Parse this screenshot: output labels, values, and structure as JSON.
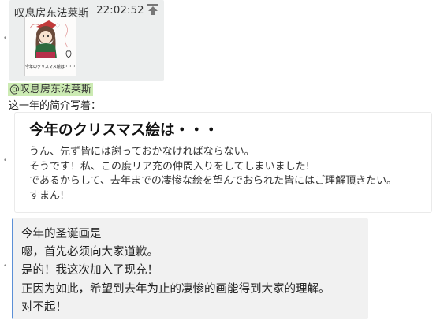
{
  "quote": {
    "sender": "叹息房东法莱斯",
    "time": "22:02:52",
    "icon": "upload-arrow-icon",
    "image_caption": "今年のクリスマス絵は・・・"
  },
  "bullet": "•",
  "mention": "@叹息房东法莱斯",
  "intro": "这一年的简介写着：",
  "card": {
    "title": "今年のクリスマス絵は・・・",
    "lines": [
      "うん、先ず皆には謝っておかなければならない。",
      "そうです！私、この度リア充の仲間入りをしてしまいました!",
      "であるからして、去年までの凄惨な絵を望んでおられた皆にはご理解頂きたい。",
      "すまん!"
    ]
  },
  "translation": {
    "lines": [
      "今年的圣诞画是",
      "嗯，首先必须向大家道歉。",
      "是的！我这次加入了现充！",
      "正因为如此，希望到去年为止的凄惨的画能得到大家的理解。",
      "对不起！"
    ]
  },
  "colors": {
    "quote_bg": "#eceeee",
    "mention_bg": "#ccebb3",
    "translation_border": "#5b8fd6",
    "translation_bg": "#f1f1f1"
  }
}
